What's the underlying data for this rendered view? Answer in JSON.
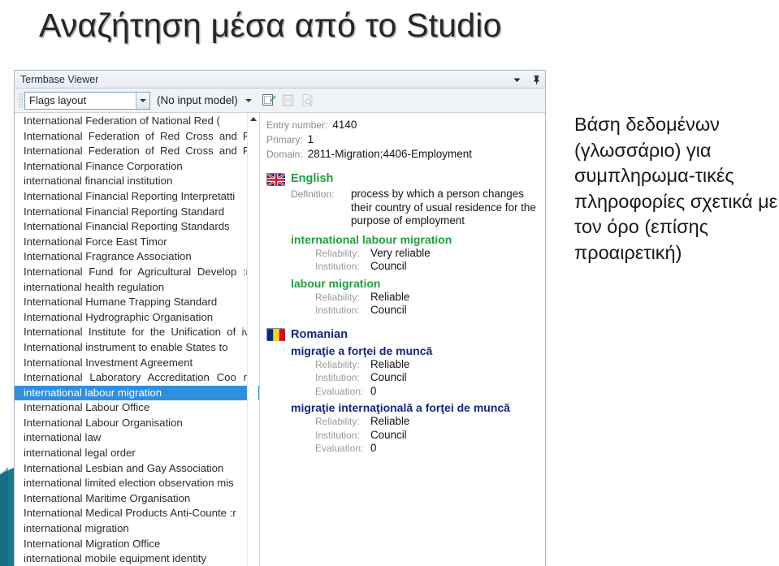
{
  "slide": {
    "title": "Αναζήτηση μέσα από το Studio",
    "caption": "Βάση δεδομένων (γλωσσάριο) για συμπληρωμα-τικές πληροφορίες σχετικά με τον όρο (επίσης προαιρετική)"
  },
  "window": {
    "title": "Termbase Viewer",
    "titlebar_icons": [
      "chevron-down-icon",
      "pin-icon"
    ],
    "toolbar": {
      "layout_combo_value": "Flags layout",
      "input_model_value": "(No input model)",
      "icons": [
        {
          "name": "edit-entry-icon",
          "enabled": true
        },
        {
          "name": "save-entry-icon",
          "enabled": false
        },
        {
          "name": "print-preview-icon",
          "enabled": false
        }
      ]
    }
  },
  "term_list": {
    "scrollbar": {
      "up_arrow": "scroll-up-arrow"
    },
    "selected_index": 18,
    "items": [
      "International Federation of National Red (",
      "International Federation of Red Cross and      F",
      "International Federation of Red Cross and      F",
      "International Finance Corporation",
      "international financial institution",
      "International Financial Reporting Interpretatti",
      "International Financial Reporting Standard",
      "International Financial Reporting Standards",
      "International Force East Timor",
      "International Fragrance Association",
      "International Fund for Agricultural Develop  :r",
      "international health regulation",
      "International Humane Trapping Standard",
      "International Hydrographic Organisation",
      "International Institute for the Unification of      iv",
      "International instrument to enable States to",
      "International Investment Agreement",
      "International  Laboratory  Accreditation Coo  n",
      "international labour migration",
      "International Labour Office",
      "International Labour Organisation",
      "international law",
      "international legal order",
      "International Lesbian and Gay Association",
      "international limited election observation mis",
      "International Maritime Organisation",
      "International Medical Products Anti-Counte :r",
      "international migration",
      "International Migration Office",
      "international mobile equipment identity"
    ]
  },
  "entry": {
    "meta": [
      {
        "label": "Entry number:",
        "value": "4140"
      },
      {
        "label": "Primary:",
        "value": "1"
      },
      {
        "label": "Domain:",
        "value": "2811-Migration;4406-Employment"
      }
    ],
    "languages": [
      {
        "flag": "uk-flag-icon",
        "name": "English",
        "color": "#1f9f3c",
        "definition_label": "Definition:",
        "definition": "process by which a person changes their country of usual residence for the purpose of employment",
        "terms": [
          {
            "name": "international labour migration",
            "attributes": [
              {
                "label": "Reliability:",
                "value": "Very reliable"
              },
              {
                "label": "Institution:",
                "value": "Council"
              }
            ]
          },
          {
            "name": "labour migration",
            "attributes": [
              {
                "label": "Reliability:",
                "value": "Reliable"
              },
              {
                "label": "Institution:",
                "value": "Council"
              }
            ]
          }
        ]
      },
      {
        "flag": "romania-flag-icon",
        "name": "Romanian",
        "color": "#16237e",
        "terms": [
          {
            "name": "migraţie a forţei de muncă",
            "attributes": [
              {
                "label": "Reliability:",
                "value": "Reliable"
              },
              {
                "label": "Institution:",
                "value": "Council"
              },
              {
                "label": "Evaluation:",
                "value": "0"
              }
            ]
          },
          {
            "name": "migraţie internaţională a forţei de muncă",
            "attributes": [
              {
                "label": "Reliability:",
                "value": "Reliable"
              },
              {
                "label": "Institution:",
                "value": "Council"
              },
              {
                "label": "Evaluation:",
                "value": "0"
              }
            ]
          }
        ]
      }
    ]
  },
  "colors": {
    "selection_blue": "#2e8fe0",
    "english_green": "#1f9f3c",
    "romanian_blue": "#16237e",
    "label_gray": "#8a8a8a",
    "deco_teal": "#1c7a93"
  }
}
